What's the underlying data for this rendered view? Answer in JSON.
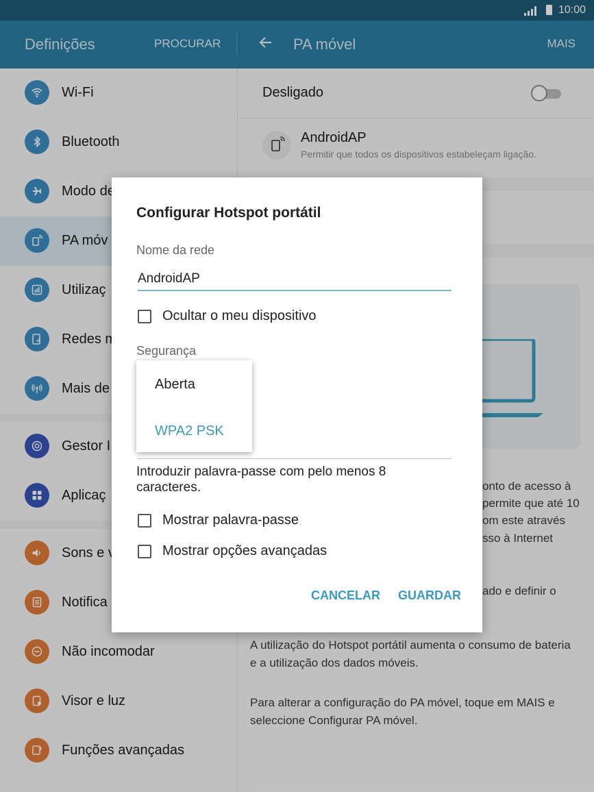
{
  "status_bar": {
    "time": "10:00"
  },
  "app_bar": {
    "left_title": "Definições",
    "search_label": "PROCURAR",
    "right_title": "PA móvel",
    "more_label": "MAIS"
  },
  "sidebar": {
    "items": [
      {
        "label": "Wi-Fi",
        "icon": "wifi-icon",
        "color": "#3d8fc2"
      },
      {
        "label": "Bluetooth",
        "icon": "bluetooth-icon",
        "color": "#3d8fc2"
      },
      {
        "label": "Modo de",
        "icon": "airplane-icon",
        "color": "#3d8fc2"
      },
      {
        "label": "PA móv",
        "icon": "hotspot-icon",
        "color": "#3d8fc2"
      },
      {
        "label": "Utilizaç",
        "icon": "data-usage-icon",
        "color": "#3d8fc2"
      },
      {
        "label": "Redes m",
        "icon": "mobile-networks-icon",
        "color": "#3d8fc2"
      },
      {
        "label": "Mais de",
        "icon": "more-connections-icon",
        "color": "#3d8fc2"
      },
      {
        "label": "Gestor I",
        "icon": "device-manager-icon",
        "color": "#3a55b8"
      },
      {
        "label": "Aplicaç",
        "icon": "apps-icon",
        "color": "#3a55b8"
      },
      {
        "label": "Sons e v",
        "icon": "sound-icon",
        "color": "#e07b3a"
      },
      {
        "label": "Notifica",
        "icon": "notifications-icon",
        "color": "#e07b3a"
      },
      {
        "label": "Não incomodar",
        "icon": "do-not-disturb-icon",
        "color": "#e07b3a"
      },
      {
        "label": "Visor e luz",
        "icon": "display-icon",
        "color": "#e07b3a"
      },
      {
        "label": "Funções avançadas",
        "icon": "advanced-features-icon",
        "color": "#e07b3a"
      }
    ]
  },
  "content": {
    "switch_label": "Desligado",
    "ap_name": "AndroidAP",
    "ap_description": "Permitir que todos os dispositivos estabeleçam ligação.",
    "text_frag_1": "onto de acesso à",
    "text_frag_2": "permite que até 10",
    "text_frag_3": "om este através",
    "text_frag_4": "sso à Internet",
    "text_frag_5": "ado e definir o",
    "para_battery": "A utilização do Hotspot portátil aumenta o consumo de bateria e a utilização dos dados móveis.",
    "para_config": "Para alterar a configuração do PA móvel, toque em MAIS e seleccione Configurar PA móvel."
  },
  "dialog": {
    "title": "Configurar Hotspot portátil",
    "network_name_label": "Nome da rede",
    "network_name_value": "AndroidAP",
    "hide_device_label": "Ocultar o meu dispositivo",
    "security_label": "Segurança",
    "password_hint": "Introduzir palavra-passe com pelo menos 8 caracteres.",
    "show_password_label": "Mostrar palavra-passe",
    "show_advanced_label": "Mostrar opções avançadas",
    "cancel_label": "CANCELAR",
    "save_label": "GUARDAR"
  },
  "security_dropdown": {
    "options": [
      "Aberta",
      "WPA2 PSK"
    ],
    "selected": "WPA2 PSK",
    "selected_color": "#3a9bc1"
  }
}
